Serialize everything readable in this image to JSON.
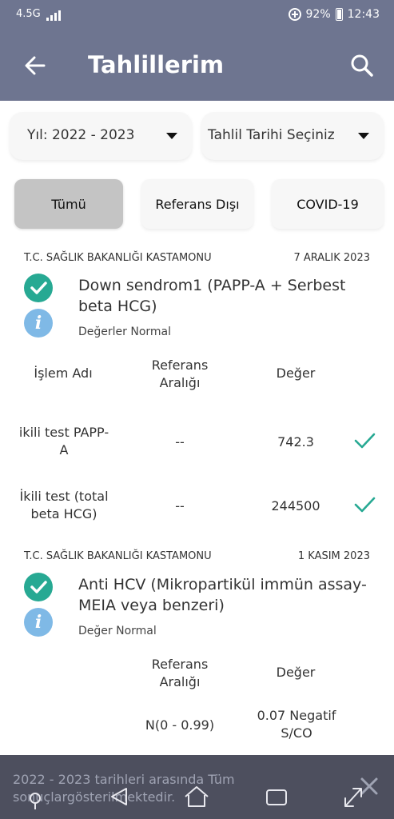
{
  "status_bar": {
    "network": "4.5G",
    "battery": "92%",
    "time": "12:43"
  },
  "app_bar": {
    "title": "Tahlillerim"
  },
  "filters": {
    "year_dropdown": "Yıl: 2022 - 2023",
    "date_dropdown": "Tahlil Tarihi Seçiniz",
    "tabs": [
      {
        "label": "Tümü",
        "active": true
      },
      {
        "label": "Referans Dışı",
        "active": false
      },
      {
        "label": "COVID-19",
        "active": false
      }
    ]
  },
  "results": [
    {
      "institution": "T.C. SAĞLIK BAKANLIĞI KASTAMONU",
      "date": "7 ARALIK 2023",
      "name": "Down sendrom1 (PAPP-A + Serbest beta HCG)",
      "status": "Değerler Normal",
      "headers": {
        "name": "İşlem Adı",
        "reference": "Referans Aralığı",
        "value": "Değer"
      },
      "rows": [
        {
          "name": "ikili test PAPP-A",
          "reference": "--",
          "value": "742.3"
        },
        {
          "name": "İkili test (total beta HCG)",
          "reference": "--",
          "value": "244500"
        }
      ]
    },
    {
      "institution": "T.C. SAĞLIK BAKANLIĞI KASTAMONU",
      "date": "1 KASIM 2023",
      "name": "Anti HCV (Mikropartikül immün assay-MEIA veya benzeri)",
      "status": "Değer Normal",
      "headers": {
        "reference": "Referans Aralığı",
        "value": "Değer"
      },
      "rows": [
        {
          "reference": "N(0 - 0.99)",
          "value": "0.07 Negatif S/CO"
        }
      ]
    }
  ],
  "toast": {
    "message": "2022 - 2023 tarihleri arasında Tüm sonuçlargösterilmektedir."
  },
  "colors": {
    "header": "#6e7590",
    "check": "#27a993",
    "info": "#7fb9e6",
    "toast": "#4d4f5e"
  }
}
